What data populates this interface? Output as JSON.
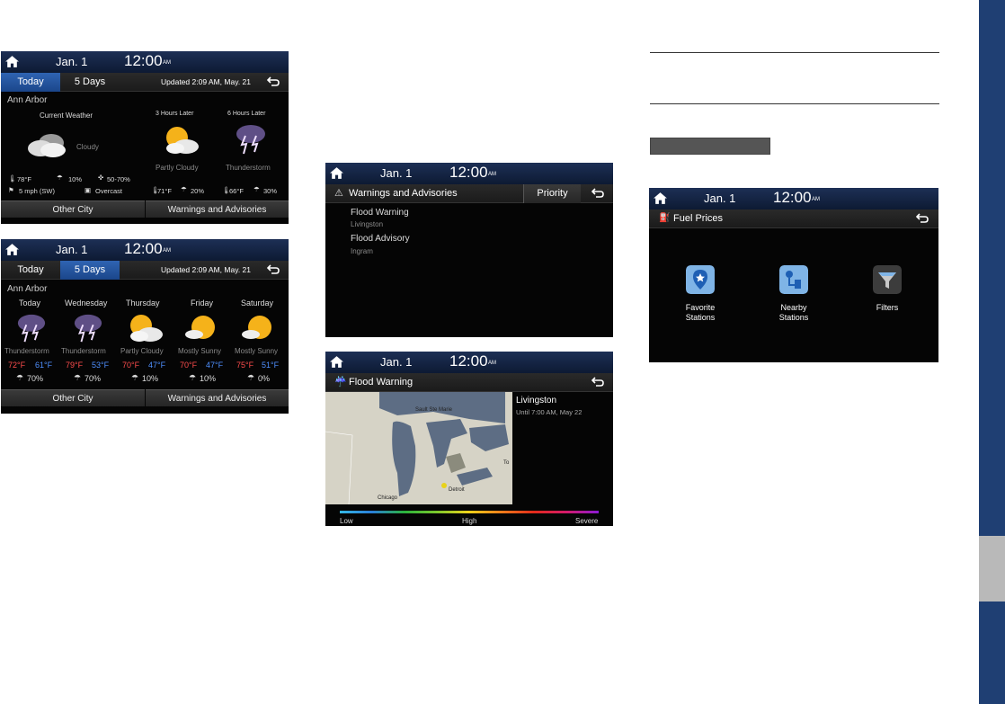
{
  "statusbar": {
    "date": "Jan.  1",
    "time": "12:00",
    "ampm": "AM"
  },
  "weather_today": {
    "tabs": [
      "Today",
      "5 Days"
    ],
    "updated": "Updated 2:09 AM, May. 21",
    "city": "Ann Arbor",
    "current_label": "Current Weather",
    "current_condition": "Cloudy",
    "later3_label": "3 Hours Later",
    "later6_label": "6 Hours Later",
    "later3_condition": "Partly Cloudy",
    "later6_condition": "Thunderstorm",
    "temp": "78°F",
    "precip": "10%",
    "humidity": "50-70%",
    "wind": "5 mph (SW)",
    "sky": "Overcast",
    "later3_temp": "71°F",
    "later3_precip": "20%",
    "later6_temp": "66°F",
    "later6_precip": "30%",
    "btn_other_city": "Other City",
    "btn_warnings": "Warnings and Advisories"
  },
  "weather_5days": {
    "tabs": [
      "Today",
      "5 Days"
    ],
    "updated": "Updated 2:09 AM, May. 21",
    "city": "Ann Arbor",
    "days": [
      {
        "name": "Today",
        "condition": "Thunderstorm",
        "high": "72°F",
        "low": "61°F",
        "precip": "70%",
        "icon": "thunderstorm-icon"
      },
      {
        "name": "Wednesday",
        "condition": "Thunderstorm",
        "high": "79°F",
        "low": "53°F",
        "precip": "70%",
        "icon": "thunderstorm-icon"
      },
      {
        "name": "Thursday",
        "condition": "Partly Cloudy",
        "high": "70°F",
        "low": "47°F",
        "precip": "10%",
        "icon": "partly-cloudy-icon"
      },
      {
        "name": "Friday",
        "condition": "Mostly Sunny",
        "high": "70°F",
        "low": "47°F",
        "precip": "10%",
        "icon": "mostly-sunny-icon"
      },
      {
        "name": "Saturday",
        "condition": "Mostly Sunny",
        "high": "75°F",
        "low": "51°F",
        "precip": "0%",
        "icon": "mostly-sunny-icon"
      }
    ],
    "btn_other_city": "Other City",
    "btn_warnings": "Warnings and Advisories"
  },
  "warnings": {
    "title": "Warnings and Advisories",
    "priority": "Priority",
    "items": [
      {
        "title": "Flood Warning",
        "place": "Livingston"
      },
      {
        "title": "Flood Advisory",
        "place": "Ingram"
      }
    ]
  },
  "flood": {
    "title": "Flood Warning",
    "place": "Livingston",
    "until": "Until 7:00 AM, May 22",
    "map_labels": [
      "Sault Ste Marie",
      "Detroit",
      "Chicago",
      "To"
    ],
    "legend": {
      "low": "Low",
      "high": "High",
      "severe": "Severe"
    }
  },
  "fuel": {
    "title": "Fuel Prices",
    "items": [
      {
        "label1": "Favorite",
        "label2": "Stations",
        "icon": "favorite-stations-icon"
      },
      {
        "label1": "Nearby",
        "label2": "Stations",
        "icon": "nearby-stations-icon"
      },
      {
        "label1": "Filters",
        "label2": "",
        "icon": "filters-icon"
      }
    ]
  }
}
